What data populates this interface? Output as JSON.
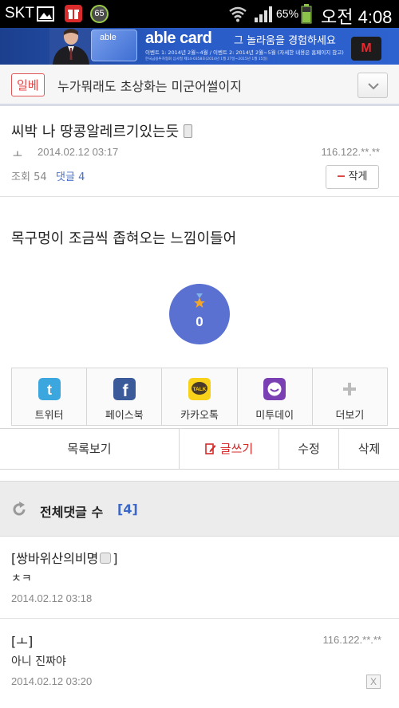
{
  "status_bar": {
    "carrier": "SKT",
    "notification_count": "65",
    "battery_percent": "65%",
    "clock": "오전 4:08"
  },
  "banner": {
    "card_label": "able",
    "brand": "able card",
    "tagline": "그 놀라움을 경험하세요",
    "fine_print": "이벤트 1: 2014년 2월~4월 / 이벤트 2: 2014년 2월~5월 (자세한 내용은 홈페이지 참고)",
    "fine_print_2": "한국금융투자협회 심사필 제14-0358호(2014년 1월 27일~2015년 1월 15일)",
    "logo": "M"
  },
  "board": {
    "tag": "일베",
    "title": "누가뭐래도 초상화는 미군어썰이지"
  },
  "post": {
    "title": "씨박 나 땅콩알레르기있는듯",
    "author": "ㅗ",
    "date": "2014.02.12 03:17",
    "ip": "116.122.**.**",
    "views_label": "조회",
    "views": "54",
    "comments_label": "댓글",
    "comments": "4",
    "small_font_label": "작게",
    "body": "목구멍이 조금씩 좁혀오는 느낌이들어",
    "recommend_count": "0"
  },
  "share": [
    {
      "label": "트위터",
      "icon": "twitter-icon",
      "color": "#3ca7df"
    },
    {
      "label": "페이스북",
      "icon": "facebook-icon",
      "color": "#3b5a9a"
    },
    {
      "label": "카카오톡",
      "icon": "kakaotalk-icon",
      "color": "#f8d21a"
    },
    {
      "label": "미투데이",
      "icon": "me2day-icon",
      "color": "#7a3fb2"
    },
    {
      "label": "더보기",
      "icon": "plus-icon",
      "color": "#bbbbbb"
    }
  ],
  "actions": {
    "list": "목록보기",
    "write": "글쓰기",
    "edit": "수정",
    "delete": "삭제"
  },
  "comments_header": {
    "title": "전체댓글 수",
    "count": "[4]"
  },
  "comments": [
    {
      "author": "[쌍바위산의비명",
      "author_end": "]",
      "text": "ㅊㅋ",
      "date": "2014.02.12 03:18",
      "ip": ""
    },
    {
      "author": "[ㅗ]",
      "author_end": "",
      "text": "아니 진짜야",
      "date": "2014.02.12 03:20",
      "ip": "116.122.**.**"
    }
  ],
  "colors": {
    "accent_red": "#e04848",
    "accent_blue": "#3b68c8",
    "recommend_bg": "#5a71d2"
  }
}
